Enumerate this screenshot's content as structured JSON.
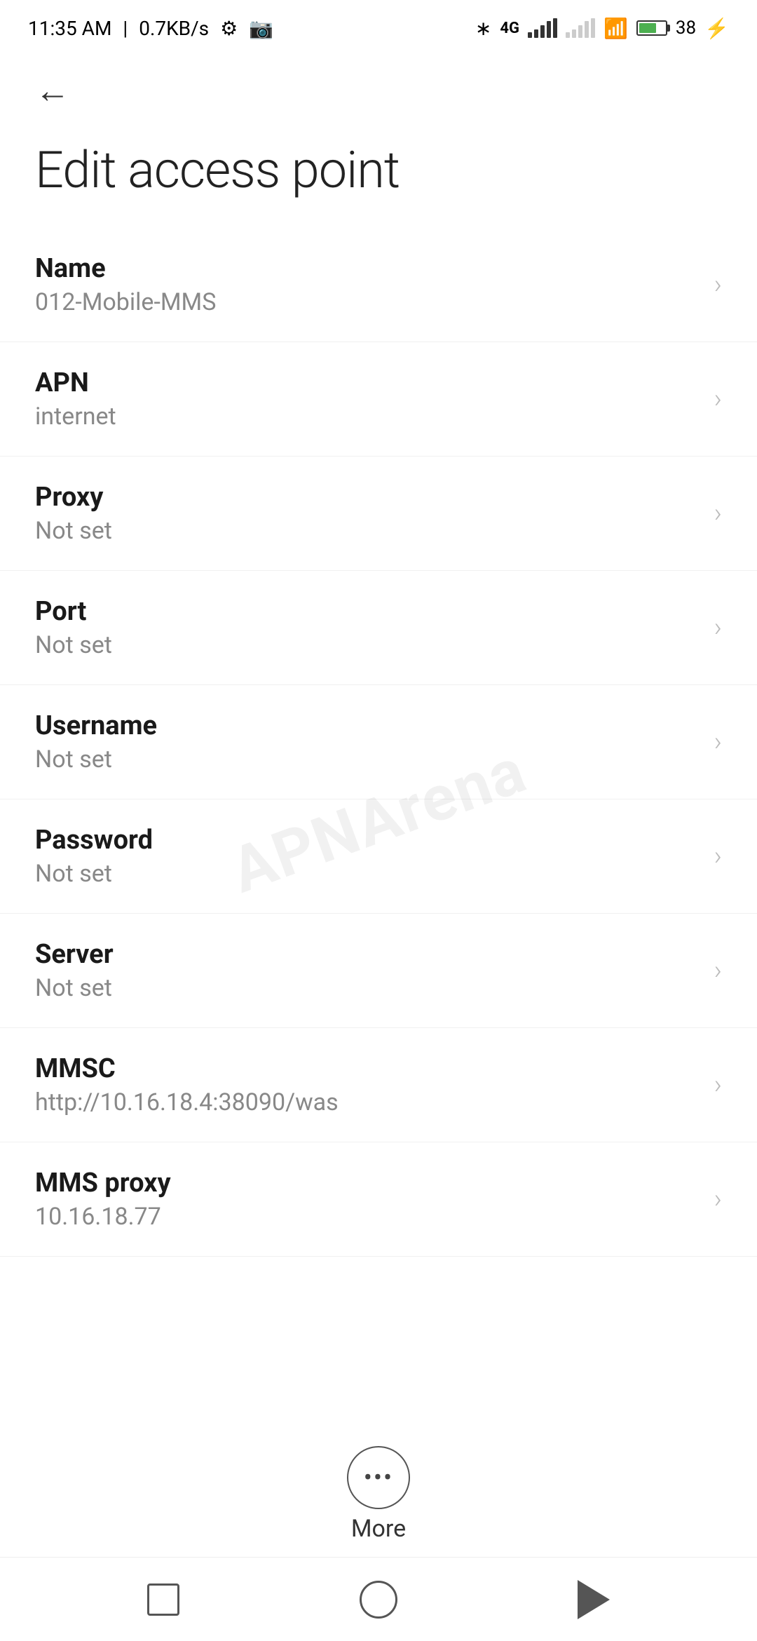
{
  "statusBar": {
    "time": "11:35 AM",
    "speed": "0.7KB/s",
    "battery": "38"
  },
  "nav": {
    "backLabel": "←"
  },
  "page": {
    "title": "Edit access point"
  },
  "items": [
    {
      "label": "Name",
      "value": "012-Mobile-MMS"
    },
    {
      "label": "APN",
      "value": "internet"
    },
    {
      "label": "Proxy",
      "value": "Not set"
    },
    {
      "label": "Port",
      "value": "Not set"
    },
    {
      "label": "Username",
      "value": "Not set"
    },
    {
      "label": "Password",
      "value": "Not set"
    },
    {
      "label": "Server",
      "value": "Not set"
    },
    {
      "label": "MMSC",
      "value": "http://10.16.18.4:38090/was"
    },
    {
      "label": "MMS proxy",
      "value": "10.16.18.77"
    }
  ],
  "more": {
    "label": "More"
  },
  "watermark": "APNArena"
}
